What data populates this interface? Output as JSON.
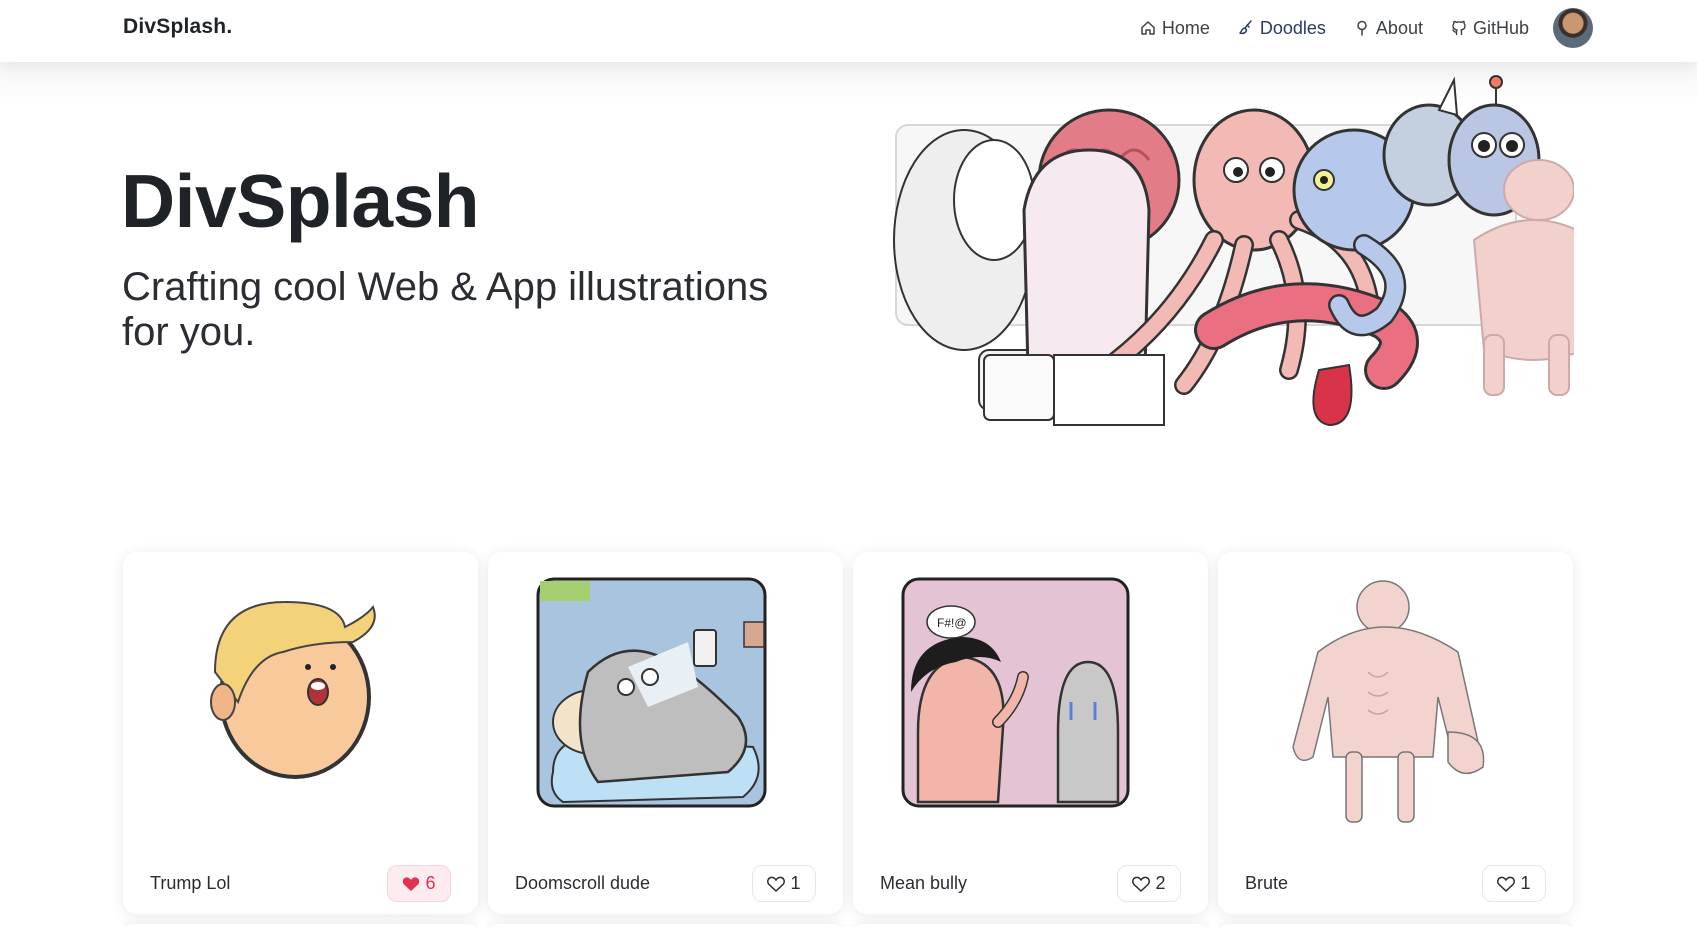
{
  "brand": "DivSplash.",
  "nav": {
    "home": "Home",
    "doodles": "Doodles",
    "about": "About",
    "github": "GitHub"
  },
  "hero": {
    "title": "DivSplash",
    "subtitle": "Crafting cool Web & App illustrations for you."
  },
  "cards": [
    {
      "title": "Trump Lol",
      "likes": "6",
      "liked": true
    },
    {
      "title": "Doomscroll dude",
      "likes": "1",
      "liked": false
    },
    {
      "title": "Mean bully",
      "likes": "2",
      "liked": false
    },
    {
      "title": "Brute",
      "likes": "1",
      "liked": false
    }
  ],
  "icons": {
    "home": "home-icon",
    "doodles": "brush-icon",
    "about": "map-pin-icon",
    "github": "github-icon",
    "like": "heart-icon"
  },
  "colors": {
    "liked": "#e0334f",
    "active_nav": "#2b3a67"
  },
  "bully_speech": "F#!@"
}
